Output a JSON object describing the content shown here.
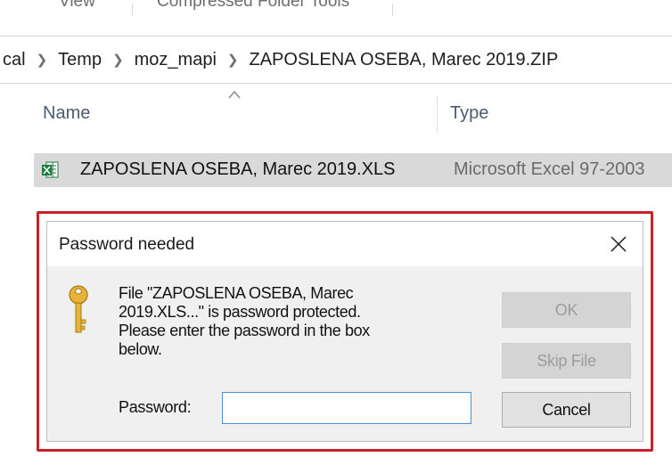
{
  "ribbon": {
    "tabs": [
      "View",
      "Compressed Folder Tools"
    ]
  },
  "address_bar": {
    "crumbs": [
      "cal",
      "Temp",
      "moz_mapi",
      "ZAPOSLENA OSEBA, Marec 2019.ZIP"
    ],
    "separator_icon": "chevron-right-icon"
  },
  "file_list": {
    "columns": [
      "Name",
      "Type"
    ],
    "sort_icon": "sort-ascending-icon",
    "rows": [
      {
        "name": "ZAPOSLENA OSEBA, Marec 2019.XLS",
        "type": "Microsoft Excel 97-2003",
        "icon": "excel-file-icon",
        "selected": true
      }
    ]
  },
  "dialog": {
    "title": "Password needed",
    "close_icon": "close-icon",
    "key_icon": "key-icon",
    "message_lines": [
      "File \"ZAPOSLENA OSEBA, Marec",
      "2019.XLS...\" is password protected.",
      "Please enter the password in the box",
      "below."
    ],
    "password_label": "Password:",
    "password_value": "",
    "buttons": {
      "ok": "OK",
      "skip_file": "Skip File",
      "cancel": "Cancel"
    },
    "highlight_color": "#c9202a"
  }
}
